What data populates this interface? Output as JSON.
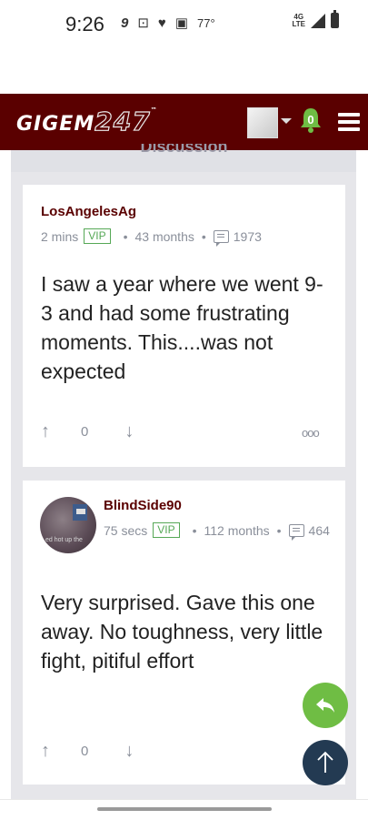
{
  "status": {
    "time": "9:26",
    "temperature": "77°",
    "network": "4G LTE",
    "icons": [
      "app-icon",
      "screen-record-icon",
      "heart-icon",
      "image-icon"
    ]
  },
  "header": {
    "logo_text": "GIGEM",
    "logo_number": "247",
    "logo_tm": "™",
    "notification_count": "0"
  },
  "section_title": "Discussion",
  "posts": [
    {
      "username": "LosAngelesAg",
      "time_ago": "2 mins",
      "badge": "VIP",
      "tenure": "43 months",
      "post_count": "1973",
      "body": "I saw a year where we went 9-3 and had some frustrating moments. This....was not expected",
      "votes": "0",
      "more": "ooo"
    },
    {
      "username": "BlindSide90",
      "time_ago": "75 secs",
      "badge": "VIP",
      "tenure": "112 months",
      "post_count": "464",
      "body": "Very surprised. Gave this one away. No toughness, very little fight, pitiful effort",
      "votes": "0",
      "avatar_caption": "ed hot up the"
    }
  ],
  "fab": {
    "reply_icon": "reply-icon",
    "scroll_top_icon": "arrow-up-icon"
  }
}
